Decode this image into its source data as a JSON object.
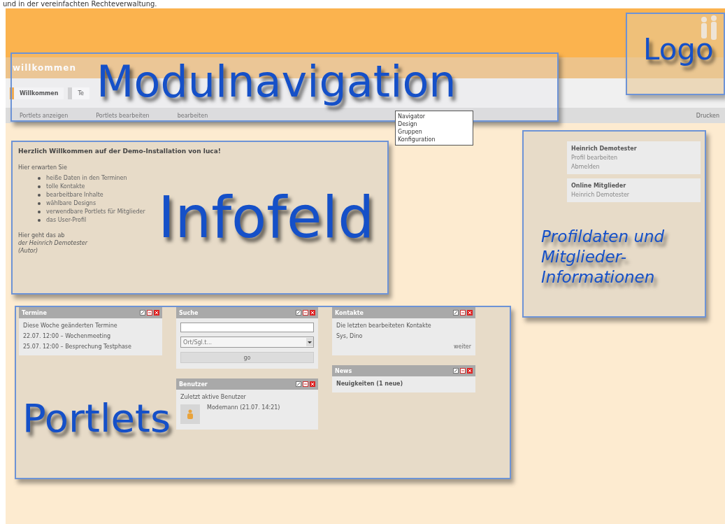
{
  "caption": "und in der vereinfachten Rechteverwaltung.",
  "header": {
    "title": "willkommen"
  },
  "tabs": [
    {
      "label": "Willkommen",
      "selected": true
    },
    {
      "label": "Te",
      "selected": false
    }
  ],
  "subnav": {
    "links": [
      "Portlets anzeigen",
      "Portlets bearbeiten",
      "bearbeiten"
    ],
    "print": "Drucken"
  },
  "dropdown": {
    "items": [
      "Navigator",
      "Design",
      "Gruppen",
      "Konfiguration"
    ]
  },
  "infofeld": {
    "heading": "Herzlich Willkommen auf der Demo-Installation von luca!",
    "intro": "Hier erwarten Sie",
    "bullets": [
      "heiße Daten in den Terminen",
      "tolle Kontakte",
      "bearbeitbare Inhalte",
      "wählbare Designs",
      "verwendbare Portlets für Mitglieder",
      "das User-Profil"
    ],
    "outro": "Hier geht das ab",
    "author": "der Heinrich Demotester",
    "role": "(Autor)"
  },
  "profile": {
    "name": "Heinrich Demotester",
    "links": [
      "Profil bearbeiten",
      "Abmelden"
    ],
    "online_title": "Online Mitglieder",
    "members": [
      "Heinrich Demotester"
    ]
  },
  "portlet_columns": [
    [
      {
        "kind": "dates",
        "title": "Termine",
        "text": "Diese Woche geänderten Termine",
        "entries": [
          "22.07. 12:00 – Wochenmeeting",
          "25.07. 12:00 – Besprechung Testphase"
        ]
      }
    ],
    [
      {
        "kind": "search",
        "title": "Suche",
        "select": "Ort/Sgl.t...",
        "button": "go"
      },
      {
        "kind": "users",
        "title": "Benutzer",
        "text": "Zuletzt aktive Benutzer",
        "entries": [
          "Modemann (21.07. 14:21)"
        ]
      }
    ],
    [
      {
        "kind": "contacts",
        "title": "Kontakte",
        "text": "Die letzten bearbeiteten Kontakte",
        "entries": [
          "Sys, Dino"
        ],
        "more": "weiter"
      },
      {
        "kind": "news",
        "title": "News",
        "text": "Neuigkeiten (1 neue)"
      }
    ]
  ],
  "annotations": {
    "navigation": "Modulnavigation",
    "logo": "Logo",
    "info": "Infofeld",
    "profile": "Profildaten und Mitglieder-Informationen",
    "portlets": "Portlets"
  }
}
